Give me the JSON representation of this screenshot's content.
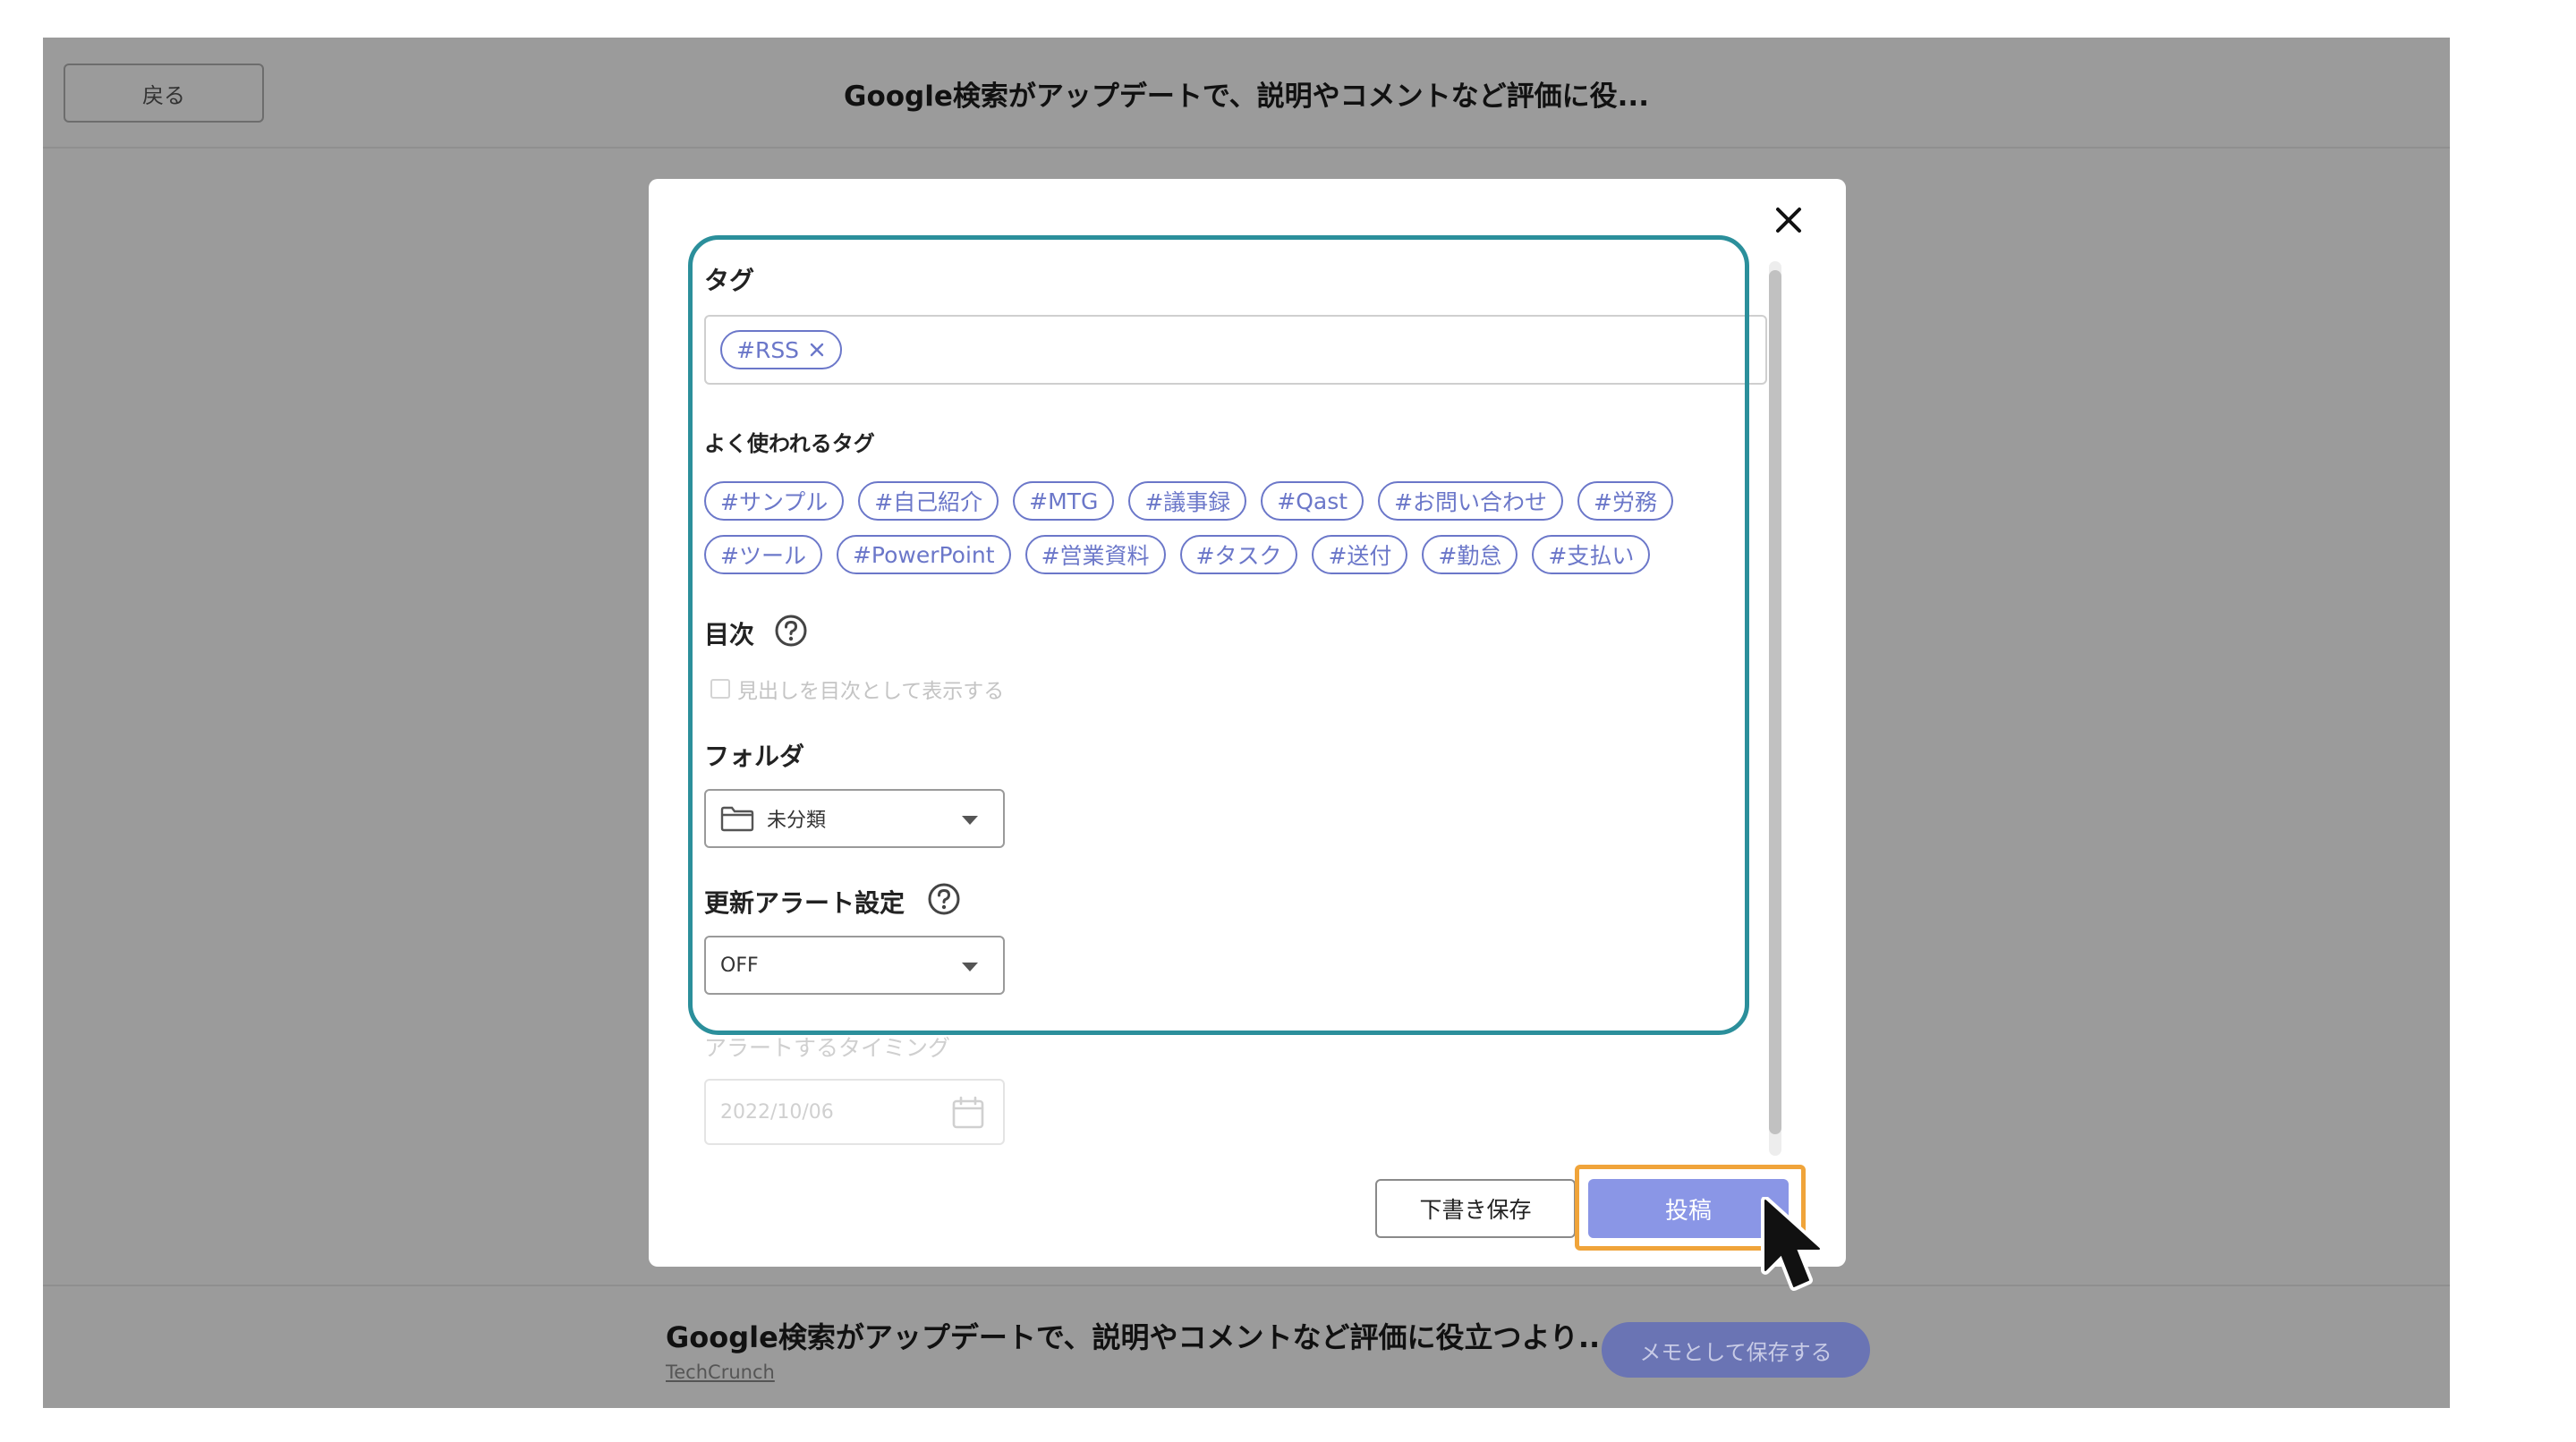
{
  "header": {
    "back_label": "戻る",
    "title": "Google検索がアップデートで、説明やコメントなど評価に役..."
  },
  "modal": {
    "tags": {
      "label": "タグ",
      "selected": [
        "#RSS"
      ],
      "frequent_label": "よく使われるタグ",
      "frequent_row1": [
        "#サンプル",
        "#自己紹介",
        "#MTG",
        "#議事録",
        "#Qast",
        "#お問い合わせ",
        "#労務"
      ],
      "frequent_row2": [
        "#ツール",
        "#PowerPoint",
        "#営業資料",
        "#タスク",
        "#送付",
        "#勤怠",
        "#支払い"
      ]
    },
    "toc": {
      "label": "目次",
      "checkbox_label": "見出しを目次として表示する"
    },
    "folder": {
      "label": "フォルダ",
      "value": "未分類"
    },
    "alert": {
      "label": "更新アラート設定",
      "value": "OFF",
      "timing_label": "アラートするタイミング",
      "date_value": "2022/10/06"
    },
    "buttons": {
      "draft_label": "下書き保存",
      "post_label": "投稿"
    }
  },
  "footer": {
    "title": "Google検索がアップデートで、説明やコメントなど評価に役立つより...",
    "source": "TechCrunch",
    "save_memo_label": "メモとして保存する"
  },
  "colors": {
    "accent": "#6b77c9",
    "post_button": "#8a96e6",
    "highlight_teal": "#2b8f9b",
    "highlight_orange": "#f0a43a"
  }
}
